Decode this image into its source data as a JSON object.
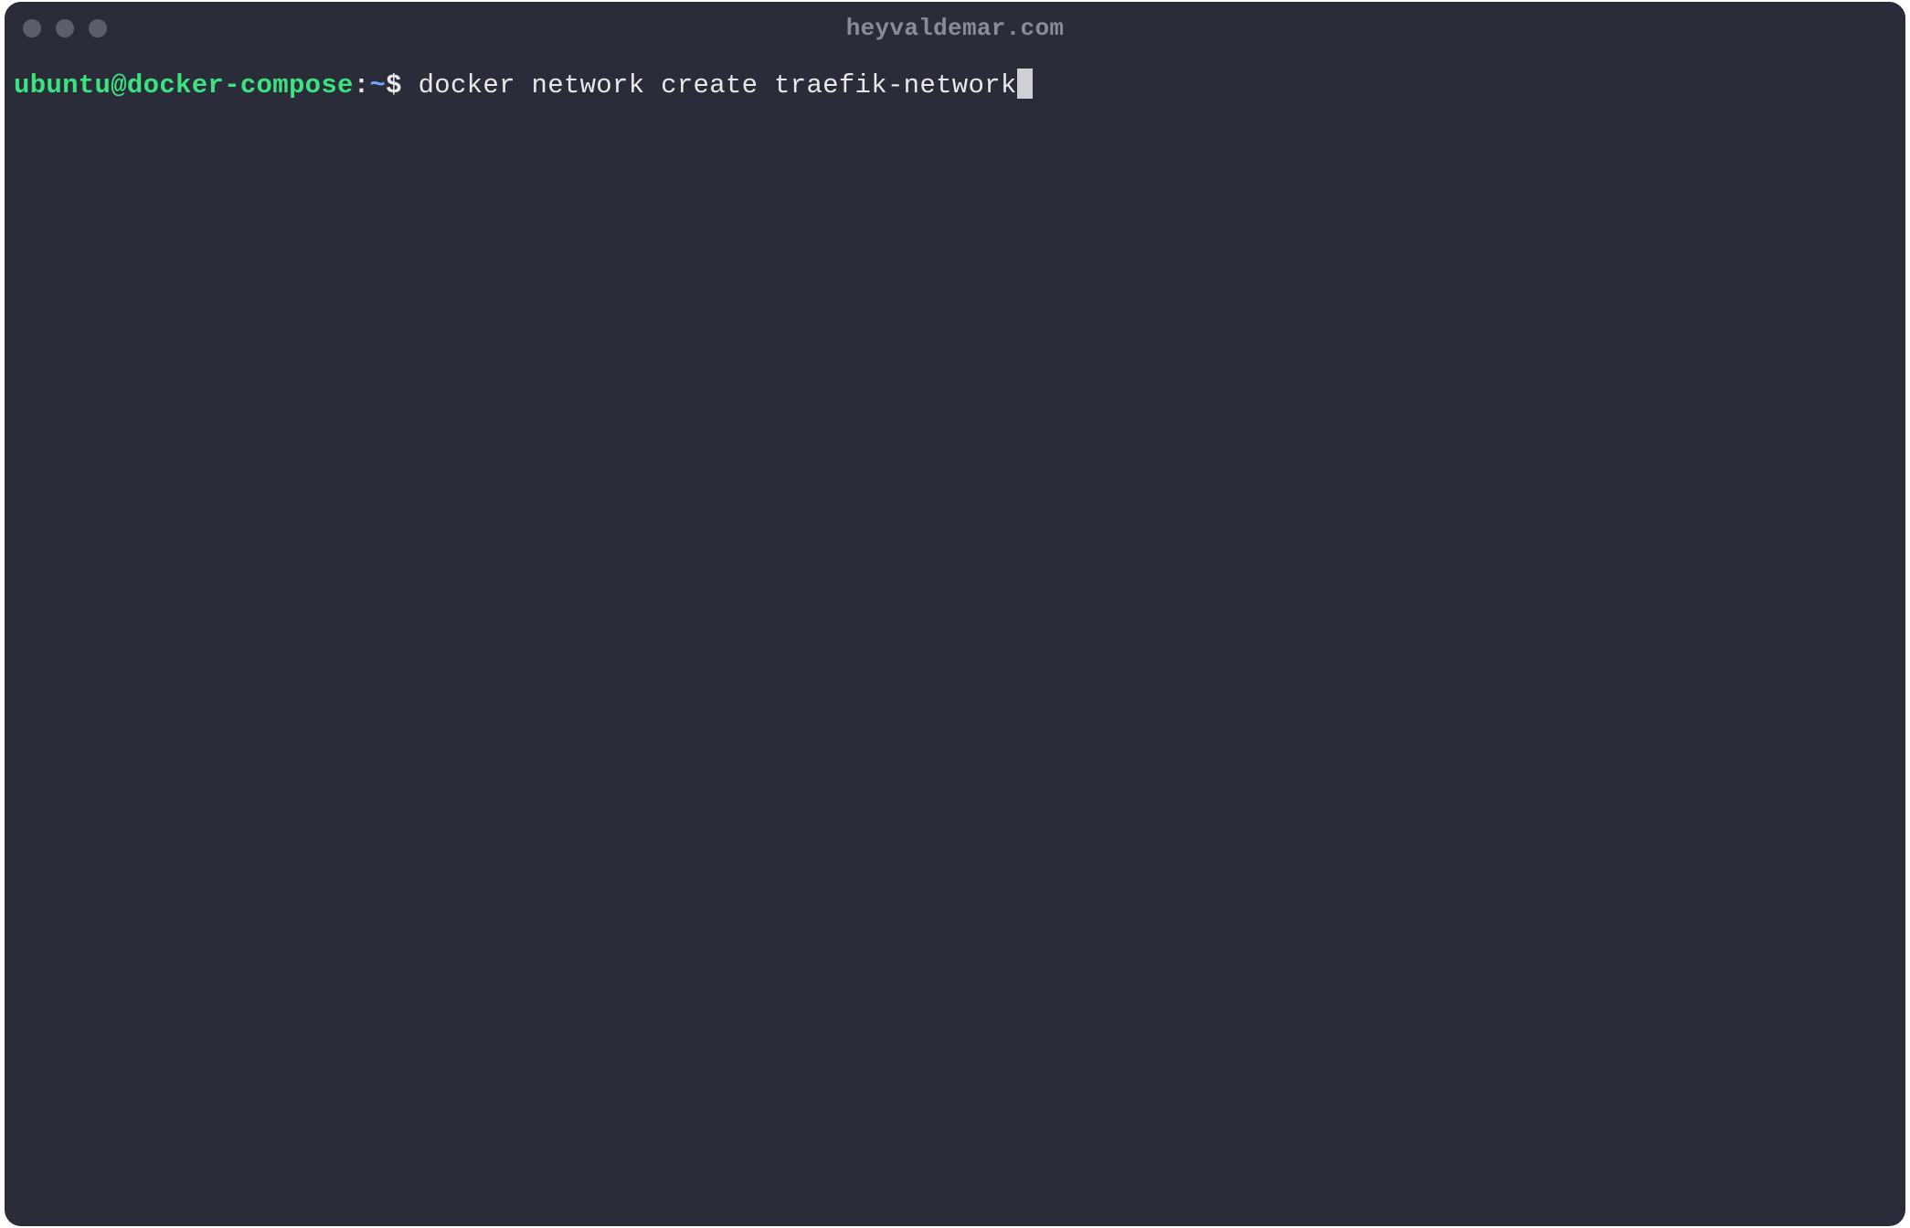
{
  "window": {
    "title": "heyvaldemar.com"
  },
  "prompt": {
    "user_host": "ubuntu@docker-compose",
    "colon": ":",
    "path": "~",
    "symbol": "$ "
  },
  "command": "docker network create traefik-network",
  "colors": {
    "bg": "#2a2c3a",
    "prompt_user_host": "#3be27e",
    "prompt_path": "#6ea8fe",
    "text": "#e8e8e8",
    "title": "#8a8c99",
    "traffic_dot": "#5c5e6c",
    "cursor": "#cfd0d4"
  }
}
